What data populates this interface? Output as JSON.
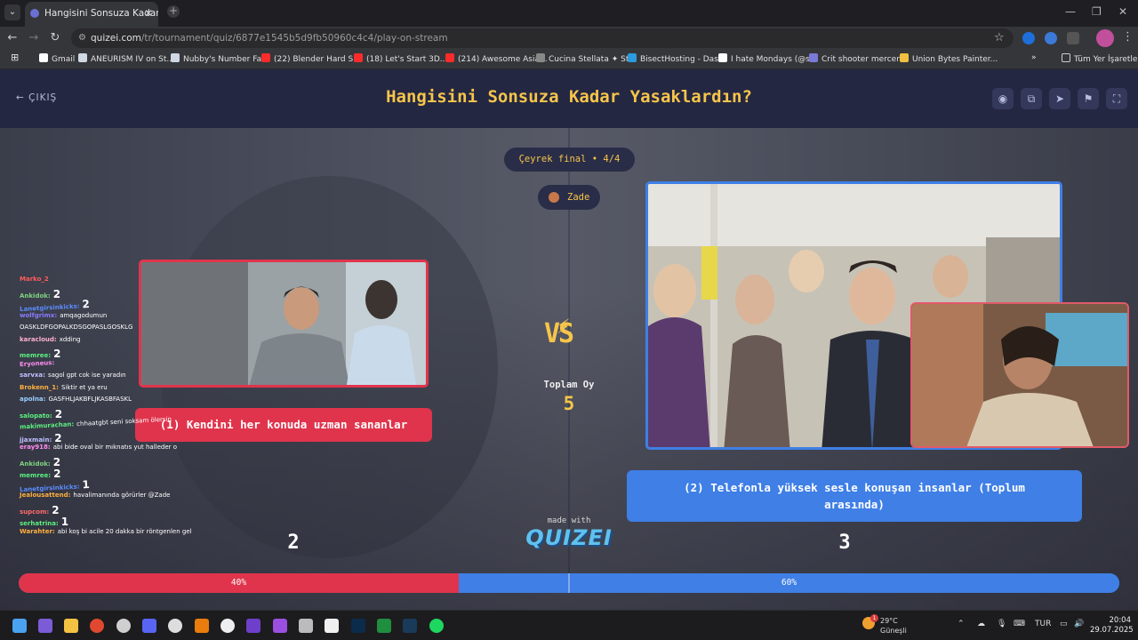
{
  "browser": {
    "tab_title": "Hangisini Sonsuza Kadar Yasakl",
    "url_host": "quizei.com",
    "url_path": "/tr/tournament/quiz/6877e1545b5d9fb50960c4c4/play-on-stream",
    "bookmarks": [
      {
        "label": "Gmail",
        "color": "#ffffff"
      },
      {
        "label": "ANEURISM IV on St...",
        "color": "#cfd8e3"
      },
      {
        "label": "Nubby's Number Fa...",
        "color": "#cfd8e3"
      },
      {
        "label": "(22) Blender Hard S...",
        "color": "#ff2b2b"
      },
      {
        "label": "(18) Let's Start 3D...",
        "color": "#ff2b2b"
      },
      {
        "label": "(214) Awesome Asia...",
        "color": "#ff2b2b"
      },
      {
        "label": "Cucina Stellata ✦ St...",
        "color": "#888888"
      },
      {
        "label": "BisectHosting - Das...",
        "color": "#2b9bdd"
      },
      {
        "label": "I hate Mondays (@s...",
        "color": "#ffffff"
      },
      {
        "label": "Crit shooter mercen...",
        "color": "#7a7ad8"
      },
      {
        "label": "Union Bytes Painter...",
        "color": "#f0c040"
      }
    ],
    "all_bookmarks": "Tüm Yer İşaretleri"
  },
  "quiz": {
    "exit_label": "ÇIKIŞ",
    "title": "Hangisini Sonsuza Kadar Yasaklardın?",
    "round": "Çeyrek final • 4/4",
    "user": "Zade",
    "total_label": "Toplam Oy",
    "total_votes": 5,
    "vs_label": "VS",
    "made_with": "made with",
    "logo": "QUIZEI",
    "options": [
      {
        "label": "(1) Kendini her konuda uzman sananlar",
        "votes": 2,
        "percent": 40,
        "color": "#e0344c"
      },
      {
        "label": "(2) Telefonla yüksek sesle konuşan insanlar (Toplum arasında)",
        "votes": 3,
        "percent": 60,
        "color": "#3f7fe6"
      }
    ],
    "percent_left_label": "40%",
    "percent_right_label": "60%",
    "title_color": "#f6c54a"
  },
  "chat": [
    {
      "user": "Marko_2",
      "msg": "",
      "big": "",
      "color": "#ff5c5c"
    },
    {
      "user": "Ankidok:",
      "msg": "",
      "big": "2",
      "color": "#7fd37f"
    },
    {
      "user": "Lanetgirsinkicks:",
      "msg": "",
      "big": "2",
      "color": "#5c8cff"
    },
    {
      "user": "wolfgrimx:",
      "msg": "amqagodumun",
      "big": "",
      "color": "#8a7aff"
    },
    {
      "user": "",
      "msg": "OASKLDFGOPALKDSGOPASLGOSKLG",
      "big": "",
      "color": "#ffffff"
    },
    {
      "user": "karacloud:",
      "msg": "xdding",
      "big": "",
      "color": "#ffb0d0"
    },
    {
      "user": "memree:",
      "msg": "",
      "big": "2",
      "color": "#5cf07f"
    },
    {
      "user": "Eryoneus:",
      "msg": "",
      "big": "",
      "color": "#ff8cf0"
    },
    {
      "user": "sarvxa:",
      "msg": "sagol gpt cok ise yaradın",
      "big": "",
      "color": "#c0c0ff"
    },
    {
      "user": "Brokenn_1:",
      "msg": "Siktir et ya eru",
      "big": "",
      "color": "#ffb040"
    },
    {
      "user": "apolna:",
      "msg": "GASFHLJAKBFLJKASBFASKL",
      "big": "",
      "color": "#9ad0ff"
    },
    {
      "user": "salopato:",
      "msg": "",
      "big": "2",
      "color": "#5cf07f"
    },
    {
      "user": "makimurachan:",
      "msg": "chhaatgbt seni soksam ölersin",
      "big": "",
      "color": "#5cf07f"
    },
    {
      "user": "jjaxmain:",
      "msg": "",
      "big": "2",
      "color": "#c0c0ff"
    },
    {
      "user": "eray918:",
      "msg": "abi bide oval bir mıknatıs yut halleder o",
      "big": "",
      "color": "#ff8cf0"
    },
    {
      "user": "Ankidok:",
      "msg": "",
      "big": "2",
      "color": "#7fd37f"
    },
    {
      "user": "memree:",
      "msg": "",
      "big": "2",
      "color": "#5cf07f"
    },
    {
      "user": "Lanetgirsinkicks:",
      "msg": "",
      "big": "1",
      "color": "#5c8cff"
    },
    {
      "user": "Jealousattend:",
      "msg": "havalimanında görürler @Zade",
      "big": "",
      "color": "#ffb040"
    },
    {
      "user": "supcom:",
      "msg": "",
      "big": "2",
      "color": "#ff6a6a"
    },
    {
      "user": "serhatrina:",
      "msg": "",
      "big": "1",
      "color": "#5cf07f"
    },
    {
      "user": "Warahter:",
      "msg": "abi koş bi acile 20 dakka bir röntgenlen gel",
      "big": "",
      "color": "#ffb040"
    }
  ],
  "taskbar": {
    "weather_temp": "29°C",
    "weather_desc": "Güneşli",
    "weather_badge": "1",
    "lang": "TUR",
    "time": "20:04",
    "date": "29.07.2025"
  }
}
